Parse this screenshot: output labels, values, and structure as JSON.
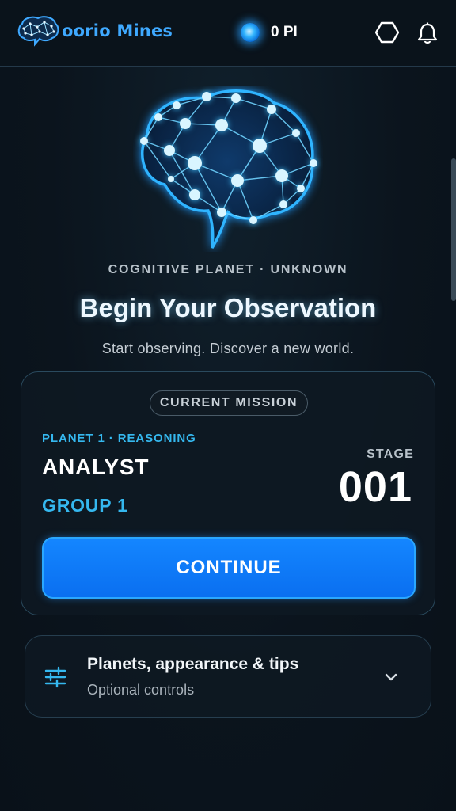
{
  "header": {
    "brand": "oorio Mines",
    "pi_balance": "0 PI",
    "icons": [
      "brain-logo-icon",
      "pi-orb-icon",
      "hexagon-icon",
      "bell-icon"
    ]
  },
  "hero": {
    "kicker": "COGNITIVE PLANET · UNKNOWN",
    "title": "Begin Your Observation",
    "subtitle": "Start observing. Discover a new world."
  },
  "mission": {
    "pill": "CURRENT MISSION",
    "planet_label": "PLANET 1 · REASONING",
    "role": "ANALYST",
    "group": "GROUP 1",
    "stage_label": "STAGE",
    "stage_number": "001",
    "continue_label": "CONTINUE"
  },
  "settings": {
    "title": "Planets, appearance & tips",
    "subtitle": "Optional controls",
    "icon": "sliders-icon",
    "expanded": false
  },
  "colors": {
    "background": "#0b141d",
    "accent_cyan": "#35b8ef",
    "button_blue": "#0a6ff0",
    "brand_blue": "#3fa9ff"
  }
}
